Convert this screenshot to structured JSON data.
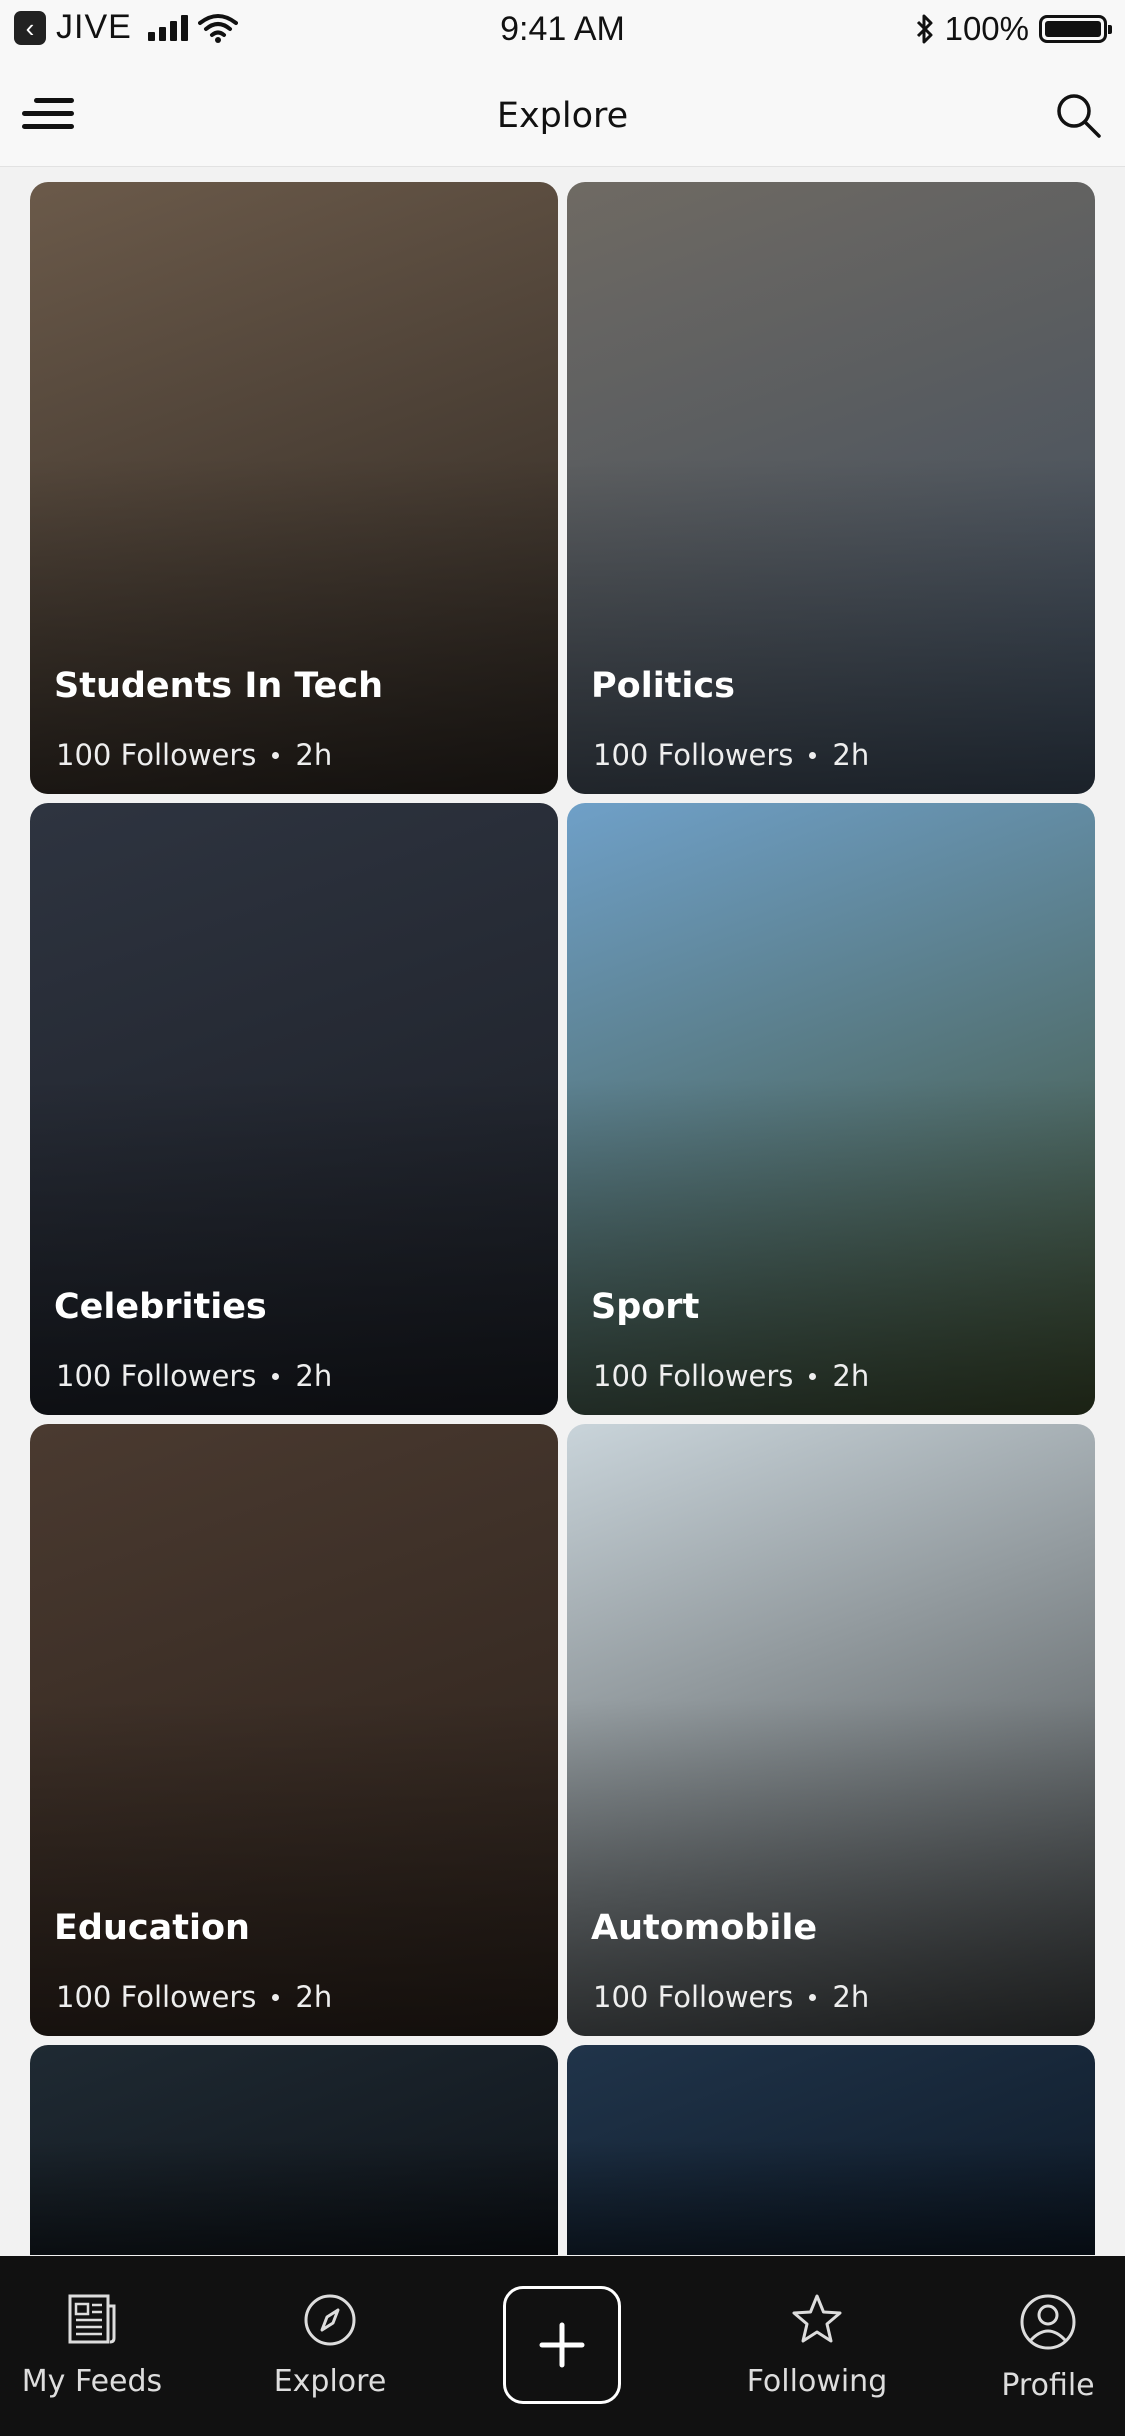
{
  "status_bar": {
    "carrier": "JIVE",
    "time": "9:41 AM",
    "battery": "100%"
  },
  "header": {
    "title": "Explore",
    "menu_icon": "menu-icon",
    "search_icon": "search-icon"
  },
  "topics": [
    {
      "title": "Students In Tech",
      "followers": "100 Followers",
      "time": "2h",
      "colors": [
        "#6b5a4a",
        "#2b2520"
      ]
    },
    {
      "title": "Politics",
      "followers": "100 Followers",
      "time": "2h",
      "colors": [
        "#6f6a63",
        "#3b4a5c"
      ]
    },
    {
      "title": "Celebrities",
      "followers": "100 Followers",
      "time": "2h",
      "colors": [
        "#2e3440",
        "#1a1d24"
      ]
    },
    {
      "title": "Sport",
      "followers": "100 Followers",
      "time": "2h",
      "colors": [
        "#6fa0c8",
        "#3b4a2c"
      ]
    },
    {
      "title": "Education",
      "followers": "100 Followers",
      "time": "2h",
      "colors": [
        "#4a3a30",
        "#2a201a"
      ]
    },
    {
      "title": "Automobile",
      "followers": "100 Followers",
      "time": "2h",
      "colors": [
        "#c9d4da",
        "#3a3d3e"
      ]
    },
    {
      "title": "",
      "followers": "",
      "time": "",
      "colors": [
        "#1f2a33",
        "#0f141a"
      ]
    },
    {
      "title": "",
      "followers": "",
      "time": "",
      "colors": [
        "#20344a",
        "#0e1a28"
      ]
    }
  ],
  "tabbar": {
    "my_feeds": "My Feeds",
    "explore": "Explore",
    "following": "Following",
    "profile": "Profile"
  }
}
